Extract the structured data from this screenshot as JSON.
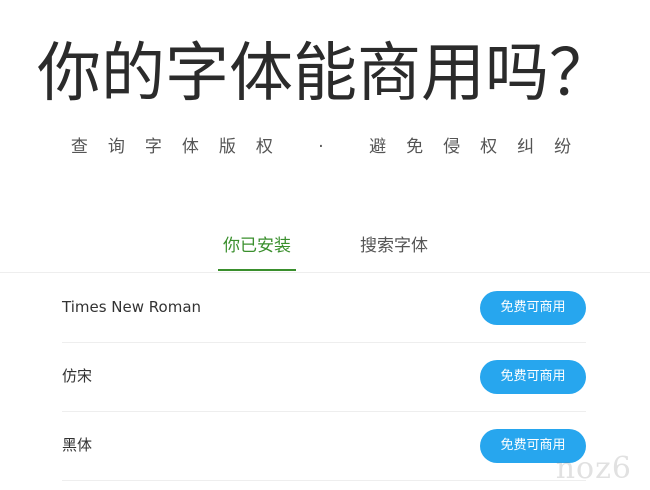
{
  "hero": {
    "title": "你的字体能商用吗？",
    "subtitle": "查询字体版权 · 避免侵权纠纷"
  },
  "tabs": [
    {
      "label": "你已安装",
      "active": true
    },
    {
      "label": "搜索字体",
      "active": false
    }
  ],
  "fonts": [
    {
      "name": "Times New Roman",
      "status": "免费可商用"
    },
    {
      "name": "仿宋",
      "status": "免费可商用"
    },
    {
      "name": "黑体",
      "status": "免费可商用"
    }
  ],
  "watermark": "noz6",
  "colors": {
    "accent_green": "#3a8f2d",
    "button_blue": "#27a6ee"
  }
}
